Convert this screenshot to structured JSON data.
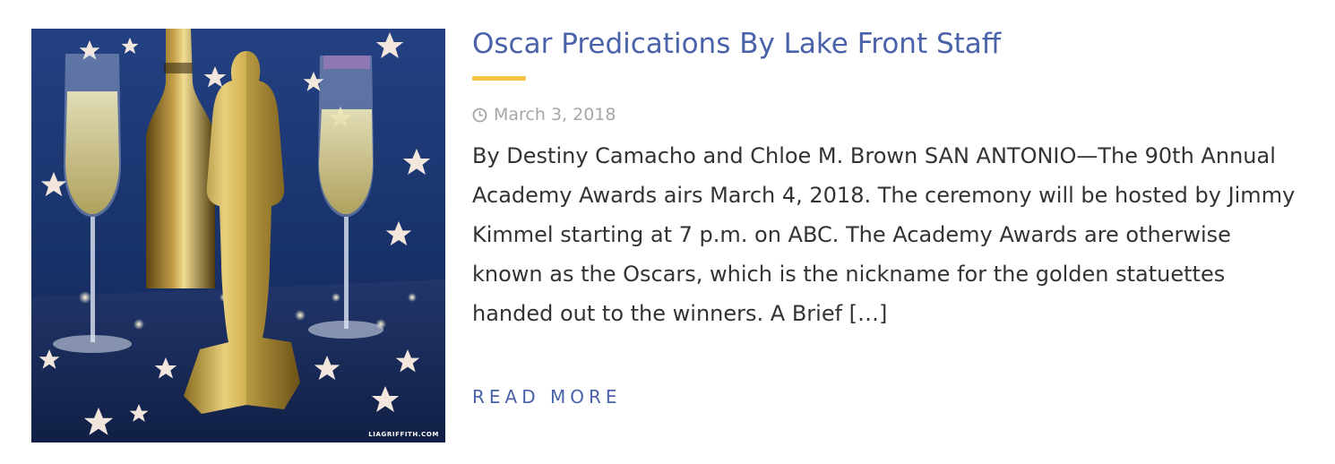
{
  "post": {
    "title": "Oscar Predications By Lake Front Staff",
    "date": "March 3, 2018",
    "date_icon": "clock-icon",
    "excerpt": "By Destiny Camacho and Chloe M. Brown SAN ANTONIO—The 90th Annual Academy Awards airs March 4, 2018. The ceremony will be hosted by Jimmy Kimmel starting at 7 p.m. on ABC. The Academy Awards are otherwise known as the Oscars, which is the nickname for the golden statuettes handed out to the winners. A Brief […]",
    "read_more": "READ MORE",
    "image": {
      "watermark": "LIAGRIFFITH.COM"
    }
  },
  "colors": {
    "title": "#4a62aa",
    "accent_divider": "#f5c443",
    "meta": "#a6a6a6",
    "body_text": "#333333",
    "image_background": "#1e3a78"
  }
}
